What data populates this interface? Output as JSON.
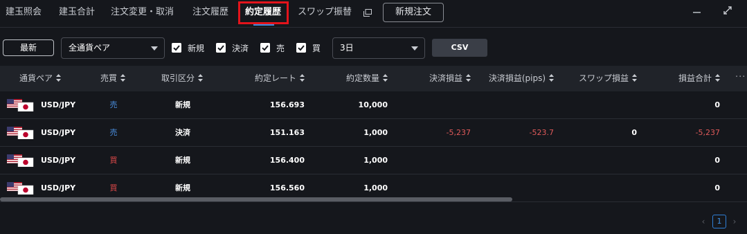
{
  "tabs": [
    {
      "label": "建玉照会"
    },
    {
      "label": "建玉合計"
    },
    {
      "label": "注文変更・取消"
    },
    {
      "label": "注文履歴"
    },
    {
      "label": "約定履歴"
    },
    {
      "label": "スワップ振替"
    }
  ],
  "header": {
    "new_order_label": "新規注文",
    "minimize_icon": "minimize-icon",
    "expand_icon": "expand-icon"
  },
  "filters": {
    "latest_label": "最新",
    "pair_select": "全通貨ペア",
    "checkboxes": [
      {
        "label": "新規",
        "checked": true
      },
      {
        "label": "決済",
        "checked": true
      },
      {
        "label": "売",
        "checked": true
      },
      {
        "label": "買",
        "checked": true
      }
    ],
    "period_select": "3日",
    "csv_label": "CSV"
  },
  "table": {
    "columns": [
      "通貨ペア",
      "売買",
      "取引区分",
      "約定レート",
      "約定数量",
      "決済損益",
      "決済損益(pips)",
      "スワップ損益",
      "損益合計"
    ],
    "rows": [
      {
        "pair": "USD/JPY",
        "side": "売",
        "type": "新規",
        "rate": "156.693",
        "qty": "10,000",
        "pl": "",
        "pl_pips": "",
        "swap": "",
        "total": "0"
      },
      {
        "pair": "USD/JPY",
        "side": "売",
        "type": "決済",
        "rate": "151.163",
        "qty": "1,000",
        "pl": "-5,237",
        "pl_pips": "-523.7",
        "swap": "0",
        "total": "-5,237"
      },
      {
        "pair": "USD/JPY",
        "side": "買",
        "type": "新規",
        "rate": "156.400",
        "qty": "1,000",
        "pl": "",
        "pl_pips": "",
        "swap": "",
        "total": "0"
      },
      {
        "pair": "USD/JPY",
        "side": "買",
        "type": "新規",
        "rate": "156.560",
        "qty": "1,000",
        "pl": "",
        "pl_pips": "",
        "swap": "",
        "total": "0"
      }
    ]
  },
  "pagination": {
    "current_page": "1"
  },
  "colors": {
    "background": "#15171c",
    "header_row": "#202329",
    "accent_blue": "#3d8fe0",
    "sell": "#4a90e2",
    "buy": "#e04a4a",
    "negative": "#e05a5a",
    "highlight_box": "#e3131b"
  }
}
